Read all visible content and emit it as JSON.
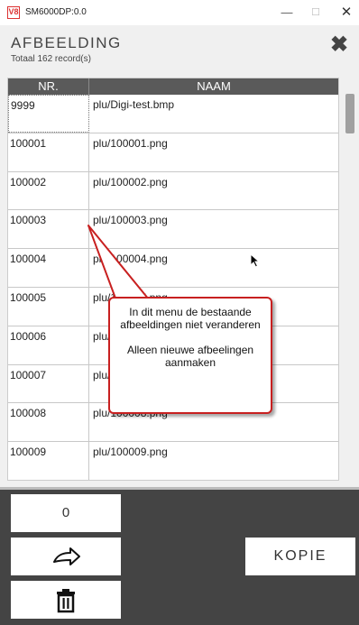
{
  "window": {
    "app_icon_label": "V8",
    "title": "SM6000DP:0.0",
    "minimize_glyph": "—",
    "maximize_glyph": "☐",
    "close_glyph": "✕"
  },
  "header": {
    "title": "AFBEELDING",
    "record_count": "Totaal 162 record(s)",
    "close_glyph": "✖"
  },
  "table": {
    "columns": [
      "NR.",
      "NAAM"
    ],
    "rows": [
      {
        "nr": "9999",
        "naam": "plu/Digi-test.bmp"
      },
      {
        "nr": "100001",
        "naam": "plu/100001.png"
      },
      {
        "nr": "100002",
        "naam": "plu/100002.png"
      },
      {
        "nr": "100003",
        "naam": "plu/100003.png"
      },
      {
        "nr": "100004",
        "naam": "plu/100004.png"
      },
      {
        "nr": "100005",
        "naam": "plu/100005.png"
      },
      {
        "nr": "100006",
        "naam": "plu/100006.png"
      },
      {
        "nr": "100007",
        "naam": "plu/100007.png"
      },
      {
        "nr": "100008",
        "naam": "plu/100008.png"
      },
      {
        "nr": "100009",
        "naam": "plu/100009.png"
      }
    ]
  },
  "callout": {
    "line1": "In dit menu de bestaande afbeeldingen niet veranderen",
    "line2": "Alleen nieuwe afbeelingen aanmaken",
    "border_color": "#c82020"
  },
  "bottom": {
    "counter_value": "0",
    "next_icon": "arrow-right-icon",
    "delete_icon": "trash-icon",
    "kopie_label": "KOPIE"
  }
}
